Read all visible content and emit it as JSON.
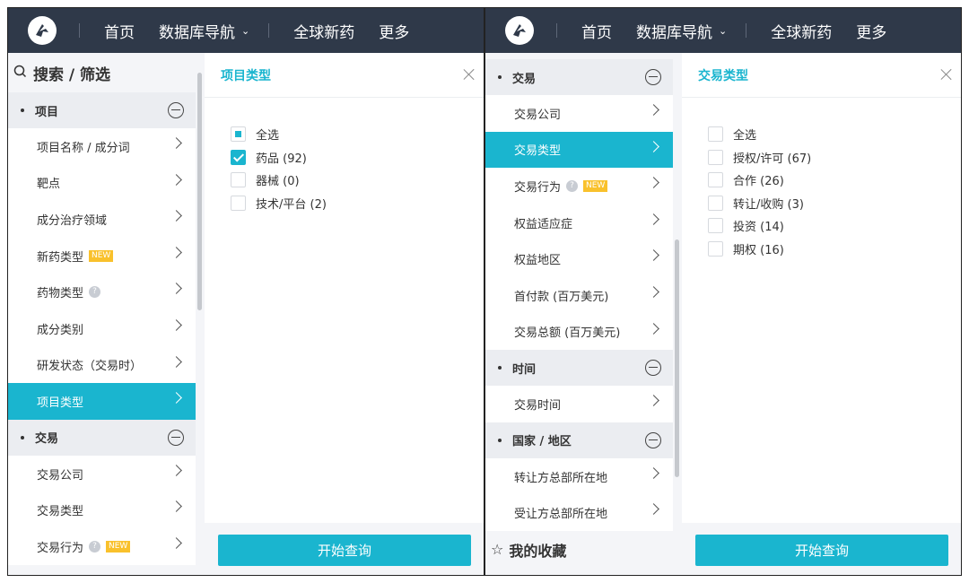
{
  "nav": {
    "home": "首页",
    "db_nav": "数据库导航",
    "db_nav_chevron": "⌄",
    "global_drugs": "全球新药",
    "more": "更多"
  },
  "left_panel": {
    "sidebar_title": "搜索 / 筛选",
    "sections": [
      {
        "title": "项目",
        "items": [
          {
            "label": "项目名称 / 成分词"
          },
          {
            "label": "靶点"
          },
          {
            "label": "成分治疗领域"
          },
          {
            "label": "新药类型",
            "badge": "NEW"
          },
          {
            "label": "药物类型",
            "help": "?"
          },
          {
            "label": "成分类别"
          },
          {
            "label": "研发状态（交易时）"
          },
          {
            "label": "项目类型",
            "active": true
          }
        ]
      },
      {
        "title": "交易",
        "items": [
          {
            "label": "交易公司"
          },
          {
            "label": "交易类型"
          },
          {
            "label": "交易行为",
            "help": "?",
            "badge": "NEW"
          }
        ]
      }
    ],
    "filter": {
      "title": "项目类型",
      "options": [
        {
          "label": "全选",
          "state": "partial"
        },
        {
          "label": "药品 (92)",
          "state": "checked"
        },
        {
          "label": "器械 (0)",
          "state": "unchecked"
        },
        {
          "label": "技术/平台 (2)",
          "state": "unchecked"
        }
      ],
      "submit": "开始查询"
    }
  },
  "right_panel": {
    "sections": [
      {
        "title": "交易",
        "items": [
          {
            "label": "交易公司"
          },
          {
            "label": "交易类型",
            "active": true
          },
          {
            "label": "交易行为",
            "help": "?",
            "badge": "NEW"
          },
          {
            "label": "权益适应症"
          },
          {
            "label": "权益地区"
          },
          {
            "label": "首付款 (百万美元)"
          },
          {
            "label": "交易总额 (百万美元)"
          }
        ]
      },
      {
        "title": "时间",
        "items": [
          {
            "label": "交易时间"
          }
        ]
      },
      {
        "title": "国家 / 地区",
        "items": [
          {
            "label": "转让方总部所在地"
          },
          {
            "label": "受让方总部所在地"
          }
        ]
      }
    ],
    "favorites": "我的收藏",
    "filter": {
      "title": "交易类型",
      "options": [
        {
          "label": "全选",
          "state": "unchecked"
        },
        {
          "label": "授权/许可 (67)",
          "state": "unchecked"
        },
        {
          "label": "合作 (26)",
          "state": "unchecked"
        },
        {
          "label": "转让/收购 (3)",
          "state": "unchecked"
        },
        {
          "label": "投资 (14)",
          "state": "unchecked"
        },
        {
          "label": "期权 (16)",
          "state": "unchecked"
        }
      ],
      "submit": "开始查询"
    }
  },
  "colors": {
    "accent": "#1ab5cf",
    "nav_bg": "#2f3949",
    "badge": "#f9c12c"
  }
}
